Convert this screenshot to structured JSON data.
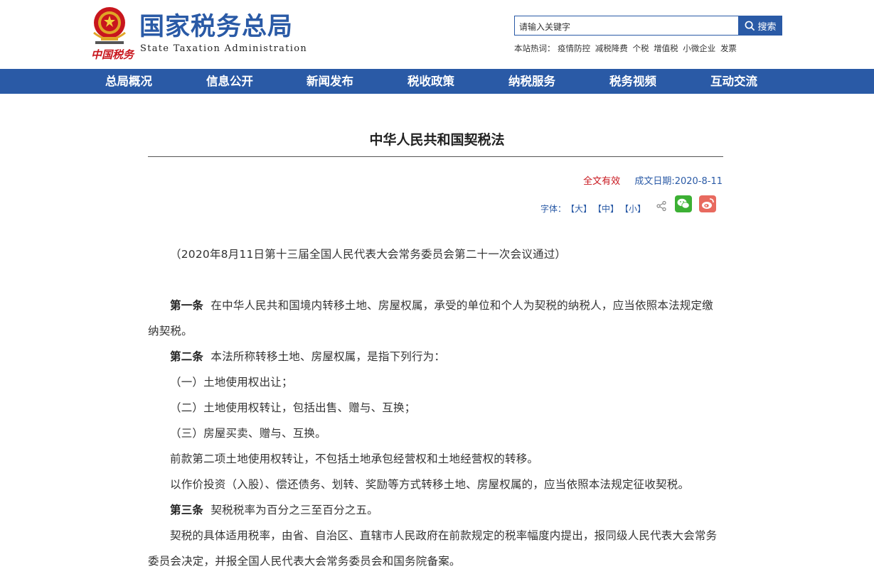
{
  "header": {
    "title": "国家税务总局",
    "subtitle": "State Taxation Administration",
    "brush_text": "中国税务"
  },
  "search": {
    "placeholder": "请输入关键字",
    "button_label": "搜索"
  },
  "hotwords": {
    "label": "本站热词：",
    "items": [
      "疫情防控",
      "减税降费",
      "个税",
      "增值税",
      "小微企业",
      "发票"
    ]
  },
  "nav": {
    "items": [
      "总局概况",
      "信息公开",
      "新闻发布",
      "税收政策",
      "纳税服务",
      "税务视频",
      "互动交流"
    ]
  },
  "article": {
    "title": "中华人民共和国契税法",
    "status": "全文有效",
    "date": "成文日期:2020-8-11",
    "font_label": "字体：",
    "font_large": "【大】",
    "font_medium": "【中】",
    "font_small": "【小】",
    "adoption_note": "（2020年8月11日第十三届全国人民代表大会常务委员会第二十一次会议通过）",
    "paragraphs": [
      {
        "bold": "第一条",
        "text": "在中华人民共和国境内转移土地、房屋权属，承受的单位和个人为契税的纳税人，应当依照本法规定缴纳契税。"
      },
      {
        "bold": "第二条",
        "text": "本法所称转移土地、房屋权属，是指下列行为："
      },
      {
        "bold": "",
        "text": "（一）土地使用权出让；"
      },
      {
        "bold": "",
        "text": "（二）土地使用权转让，包括出售、赠与、互换；"
      },
      {
        "bold": "",
        "text": "（三）房屋买卖、赠与、互换。"
      },
      {
        "bold": "",
        "text": "前款第二项土地使用权转让，不包括土地承包经营权和土地经营权的转移。"
      },
      {
        "bold": "",
        "text": "以作价投资（入股）、偿还债务、划转、奖励等方式转移土地、房屋权属的，应当依照本法规定征收契税。"
      },
      {
        "bold": "第三条",
        "text": "契税税率为百分之三至百分之五。"
      },
      {
        "bold": "",
        "text": "契税的具体适用税率，由省、自治区、直辖市人民政府在前款规定的税率幅度内提出，报同级人民代表大会常务委员会决定，并报全国人民代表大会常务委员会和国务院备案。"
      }
    ]
  },
  "colors": {
    "brand_blue": "#2a5aa6",
    "status_red": "#c8161d",
    "wechat_green": "#3cb034",
    "weibo_red": "#e86a5f"
  }
}
